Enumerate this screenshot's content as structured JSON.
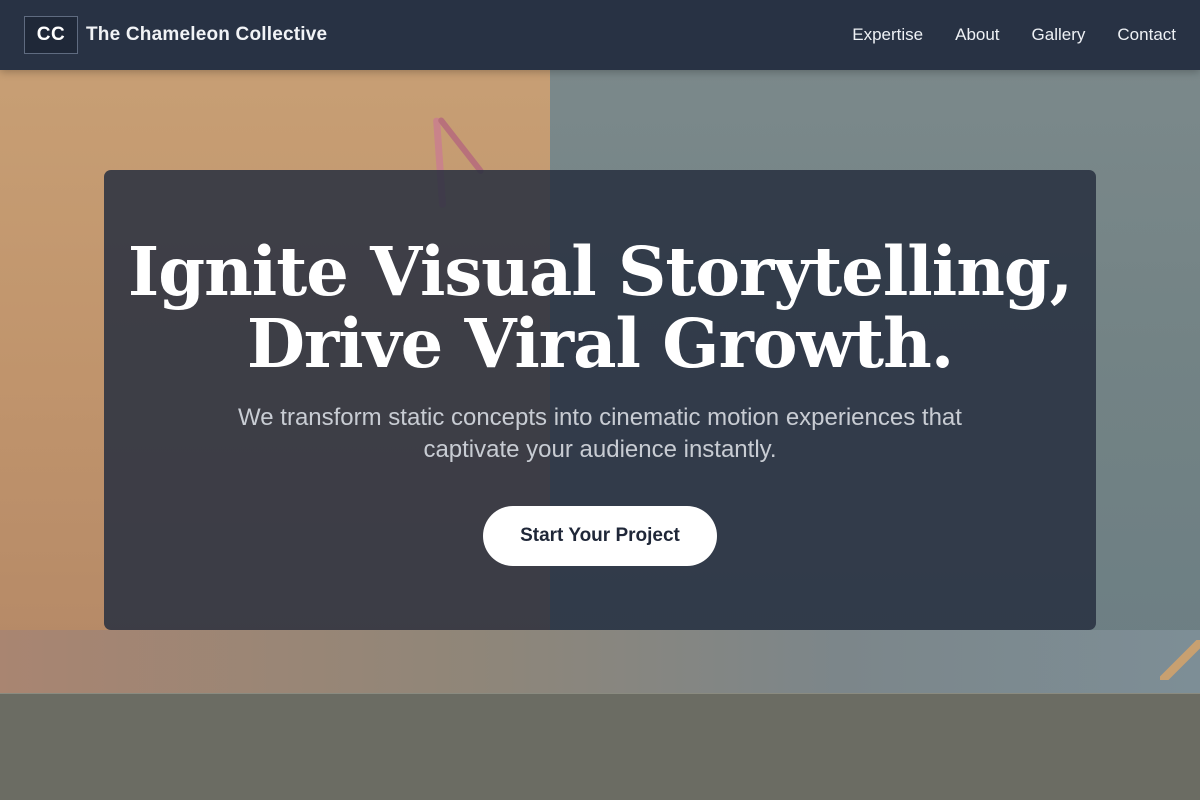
{
  "header": {
    "logo_text": "CC",
    "brand_name": "The Chameleon Collective",
    "nav": [
      {
        "label": "Expertise"
      },
      {
        "label": "About"
      },
      {
        "label": "Gallery"
      },
      {
        "label": "Contact"
      }
    ]
  },
  "hero": {
    "title_line1": "Ignite Visual Storytelling,",
    "title_line2": "Drive Viral Growth.",
    "subtitle": "We transform static concepts into cinematic motion experiences that captivate your audience instantly.",
    "cta_label": "Start Your Project"
  },
  "colors": {
    "header_bg": "#283244",
    "card_bg": "#283040",
    "cta_bg": "#ffffff",
    "cta_text": "#1f2738"
  }
}
